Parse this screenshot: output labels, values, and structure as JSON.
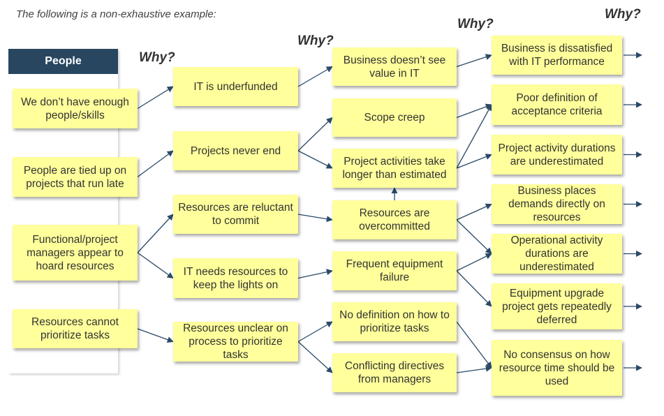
{
  "intro": "The following is a non-exhaustive example:",
  "category": "People",
  "why_label": "Why?",
  "colors": {
    "node_fill": "#ffff9b",
    "header_fill": "#284660",
    "arrow": "#2b4a68"
  },
  "columns": [
    {
      "level": 1,
      "nodes": [
        {
          "id": "c1a",
          "text": "We don’t have enough people/skills"
        },
        {
          "id": "c1b",
          "text": "People are tied up on projects that run late"
        },
        {
          "id": "c1c",
          "text": "Functional/project managers appear to hoard resources"
        },
        {
          "id": "c1d",
          "text": "Resources cannot prioritize tasks"
        }
      ]
    },
    {
      "level": 2,
      "nodes": [
        {
          "id": "c2a",
          "text": "IT is underfunded"
        },
        {
          "id": "c2b",
          "text": "Projects never end"
        },
        {
          "id": "c2c",
          "text": "Resources are reluctant to commit"
        },
        {
          "id": "c2d",
          "text": "IT needs resources to keep the lights on"
        },
        {
          "id": "c2e",
          "text": "Resources unclear on process to prioritize tasks"
        }
      ]
    },
    {
      "level": 3,
      "nodes": [
        {
          "id": "c3a",
          "text": "Business doesn’t see value in IT"
        },
        {
          "id": "c3b",
          "text": "Scope creep"
        },
        {
          "id": "c3c",
          "text": "Project activities take longer than estimated"
        },
        {
          "id": "c3d",
          "text": "Resources are overcommitted"
        },
        {
          "id": "c3e",
          "text": "Frequent equipment failure"
        },
        {
          "id": "c3f",
          "text": "No definition on how to prioritize tasks"
        },
        {
          "id": "c3g",
          "text": "Conflicting directives from managers"
        }
      ]
    },
    {
      "level": 4,
      "nodes": [
        {
          "id": "c4a",
          "text": "Business is dissatisfied with IT performance"
        },
        {
          "id": "c4b",
          "text": "Poor definition of acceptance criteria"
        },
        {
          "id": "c4c",
          "text": "Project activity durations are underestimated"
        },
        {
          "id": "c4d",
          "text": "Business places demands directly on resources"
        },
        {
          "id": "c4e",
          "text": "Operational activity durations are underestimated"
        },
        {
          "id": "c4f",
          "text": "Equipment upgrade project gets repeatedly deferred"
        },
        {
          "id": "c4g",
          "text": "No consensus on how resource time should be used"
        }
      ]
    }
  ],
  "edges": [
    [
      "c1a",
      "c2a"
    ],
    [
      "c1b",
      "c2b"
    ],
    [
      "c1c",
      "c2c"
    ],
    [
      "c1c",
      "c2d"
    ],
    [
      "c1d",
      "c2e"
    ],
    [
      "c2a",
      "c3a"
    ],
    [
      "c2b",
      "c3b"
    ],
    [
      "c2b",
      "c3c"
    ],
    [
      "c2c",
      "c3d"
    ],
    [
      "c2d",
      "c3e"
    ],
    [
      "c2e",
      "c3f"
    ],
    [
      "c2e",
      "c3g"
    ],
    [
      "c3a",
      "c4a"
    ],
    [
      "c3b",
      "c4b"
    ],
    [
      "c3c",
      "c4b"
    ],
    [
      "c3c",
      "c4c"
    ],
    [
      "c3d",
      "c3c"
    ],
    [
      "c3d",
      "c4d"
    ],
    [
      "c3d",
      "c4e"
    ],
    [
      "c3e",
      "c4e"
    ],
    [
      "c3e",
      "c4f"
    ],
    [
      "c3f",
      "c4g"
    ],
    [
      "c3g",
      "c4g"
    ]
  ],
  "continuation_arrows": [
    "c4a",
    "c4b",
    "c4c",
    "c4d",
    "c4e",
    "c4f",
    "c4g"
  ]
}
